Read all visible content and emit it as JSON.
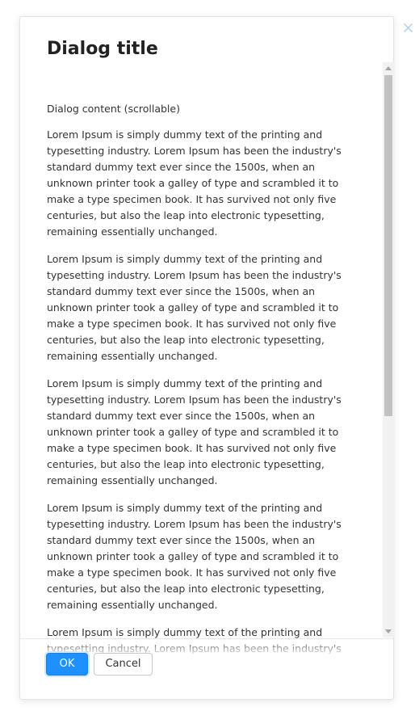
{
  "dialog": {
    "title": "Dialog title",
    "content_heading": "Dialog content (scrollable)",
    "paragraphs": [
      "Lorem Ipsum is simply dummy text of the printing and typesetting industry. Lorem Ipsum has been the industry's standard dummy text ever since the 1500s, when an unknown printer took a galley of type and scrambled it to make a type specimen book. It has survived not only five centuries, but also the leap into electronic typesetting, remaining essentially unchanged.",
      "Lorem Ipsum is simply dummy text of the printing and typesetting industry. Lorem Ipsum has been the industry's standard dummy text ever since the 1500s, when an unknown printer took a galley of type and scrambled it to make a type specimen book. It has survived not only five centuries, but also the leap into electronic typesetting, remaining essentially unchanged.",
      "Lorem Ipsum is simply dummy text of the printing and typesetting industry. Lorem Ipsum has been the industry's standard dummy text ever since the 1500s, when an unknown printer took a galley of type and scrambled it to make a type specimen book. It has survived not only five centuries, but also the leap into electronic typesetting, remaining essentially unchanged.",
      "Lorem Ipsum is simply dummy text of the printing and typesetting industry. Lorem Ipsum has been the industry's standard dummy text ever since the 1500s, when an unknown printer took a galley of type and scrambled it to make a type specimen book. It has survived not only five centuries, but also the leap into electronic typesetting, remaining essentially unchanged.",
      "Lorem Ipsum is simply dummy text of the printing and typesetting industry. Lorem Ipsum has been the industry's"
    ],
    "ok_label": "OK",
    "cancel_label": "Cancel",
    "close_icon": "close-icon"
  },
  "colors": {
    "primary": "#1e90ff",
    "close_icon": "#b9d3e8",
    "scrollbar_thumb": "#c1c1c1"
  }
}
